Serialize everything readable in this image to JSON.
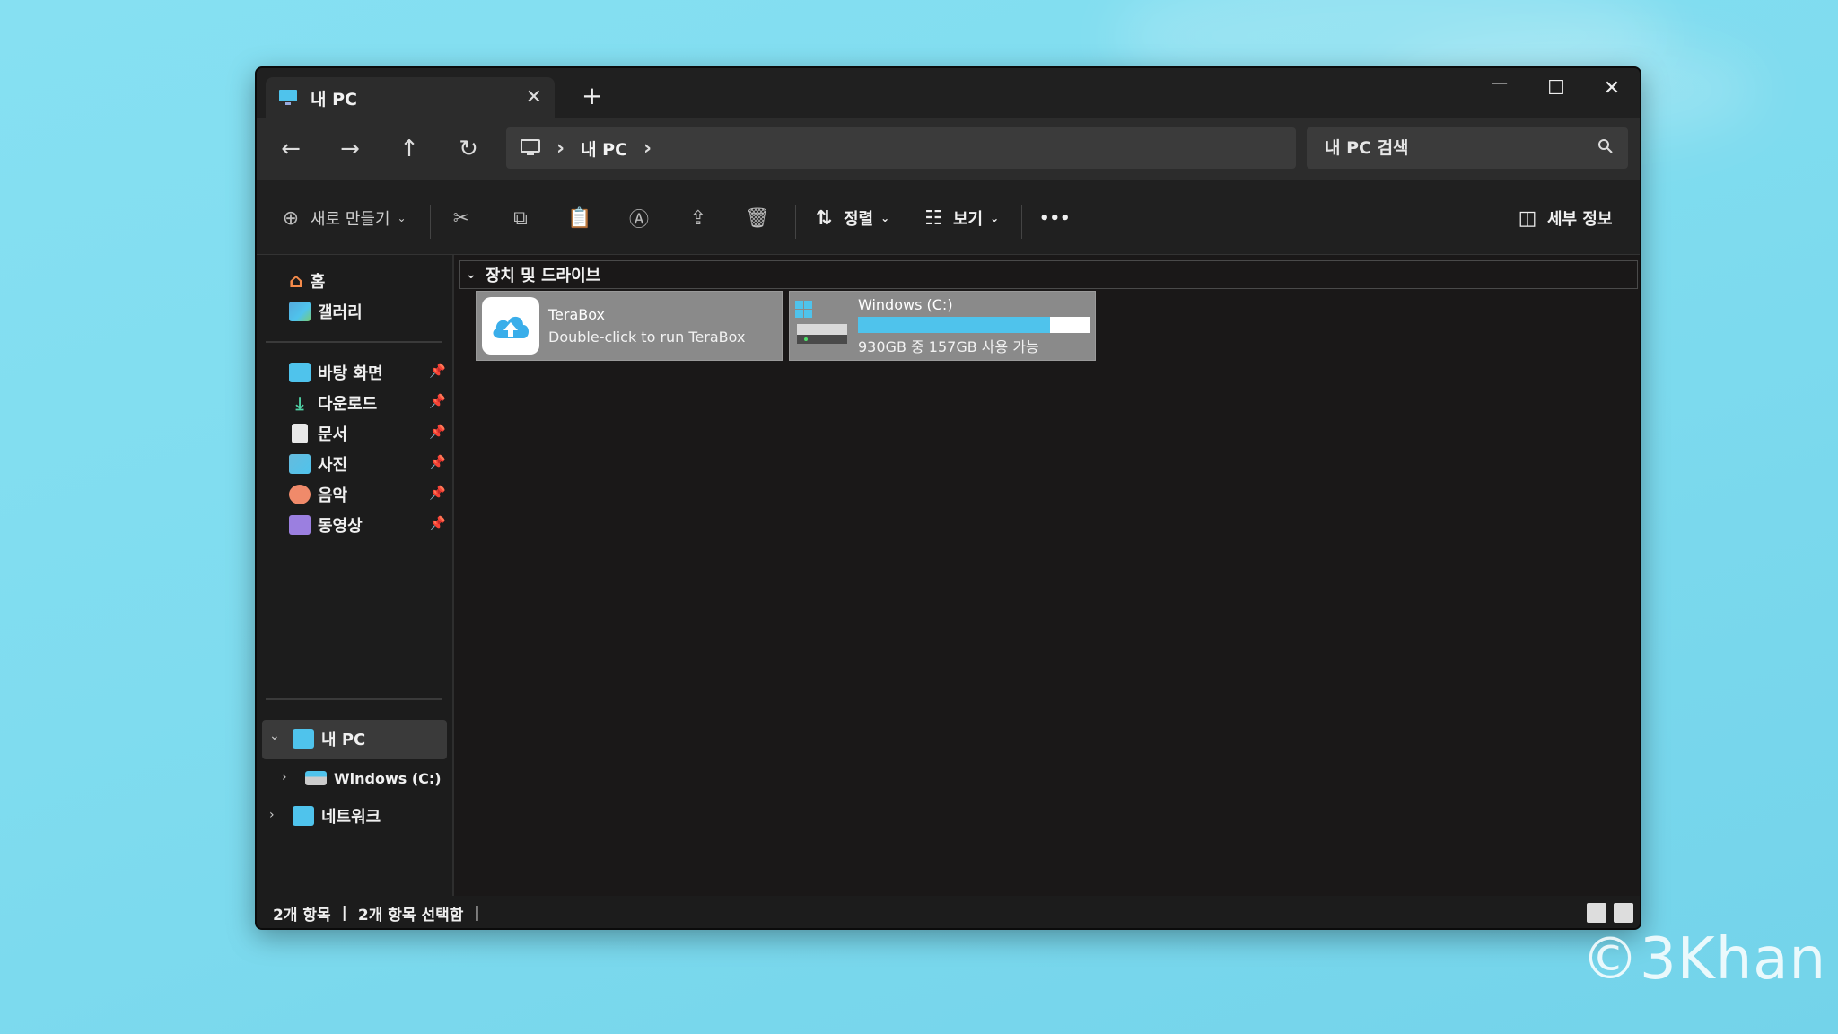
{
  "tab": {
    "title": "내 PC",
    "close": "✕",
    "new": "+"
  },
  "window_controls": {
    "minimize": "—",
    "maximize": "☐",
    "close": "✕"
  },
  "nav": {
    "back": "←",
    "forward": "→",
    "up": "↑",
    "refresh": "↻"
  },
  "address": {
    "segment": "내 PC",
    "chevron": "›"
  },
  "search": {
    "placeholder": "내 PC 검색"
  },
  "toolbar": {
    "new_label": "새로 만들기",
    "sort_label": "정렬",
    "view_label": "보기",
    "more": "•••",
    "details_label": "세부 정보"
  },
  "sidebar": {
    "top": [
      {
        "label": "홈"
      },
      {
        "label": "갤러리"
      }
    ],
    "pinned": [
      {
        "label": "바탕 화면"
      },
      {
        "label": "다운로드"
      },
      {
        "label": "문서"
      },
      {
        "label": "사진"
      },
      {
        "label": "음악"
      },
      {
        "label": "동영상"
      }
    ],
    "tree": [
      {
        "label": "내 PC"
      },
      {
        "label": "Windows (C:)"
      },
      {
        "label": "네트워크"
      }
    ]
  },
  "group": {
    "title": "장치 및 드라이브"
  },
  "items": [
    {
      "name": "TeraBox",
      "subtitle": "Double-click to run TeraBox"
    },
    {
      "name": "Windows (C:)",
      "subtitle": "930GB 중 157GB 사용 가능",
      "used_fraction": 0.83
    }
  ],
  "status": {
    "count": "2개 항목",
    "selected": "2개 항목 선택함",
    "sep": "|"
  },
  "watermark": "©3Khan",
  "colors": {
    "accent": "#4fc3ec",
    "background": "#7fdcef",
    "window": "#1a1818"
  }
}
